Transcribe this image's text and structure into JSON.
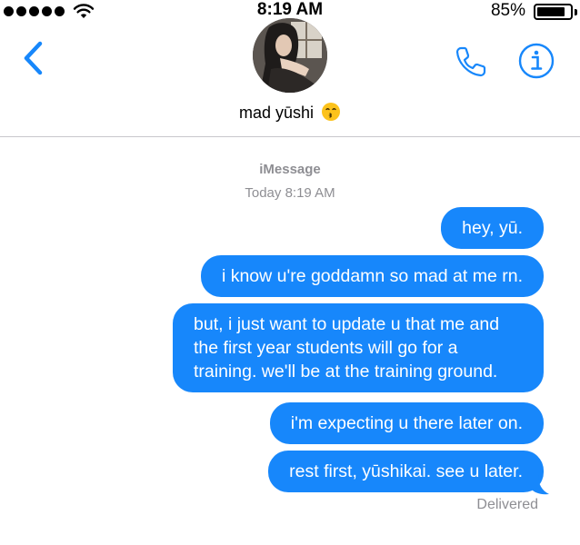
{
  "status_bar": {
    "time": "8:19 AM",
    "battery_percent": "85%",
    "battery_level": 0.85
  },
  "header": {
    "back_icon": "chevron-left-icon",
    "contact_name": "mad yūshi",
    "contact_emoji": "kissing-face-emoji",
    "call_icon": "phone-icon",
    "info_icon": "info-icon"
  },
  "conversation": {
    "service": "iMessage",
    "timestamp": "Today 8:19 AM",
    "messages": [
      {
        "text": "hey, yū."
      },
      {
        "text": "i know u're goddamn so mad at me rn."
      },
      {
        "text": "but, i just want to update u that me and the first year students will go for a training. we'll be at the training ground."
      },
      {
        "text": "i'm expecting u there later on."
      },
      {
        "text": "rest first, yūshikai. see u later."
      }
    ],
    "delivery_status": "Delivered"
  },
  "colors": {
    "accent": "#1787fb",
    "bubble_text": "#ffffff",
    "meta_text": "#8e8e93"
  }
}
